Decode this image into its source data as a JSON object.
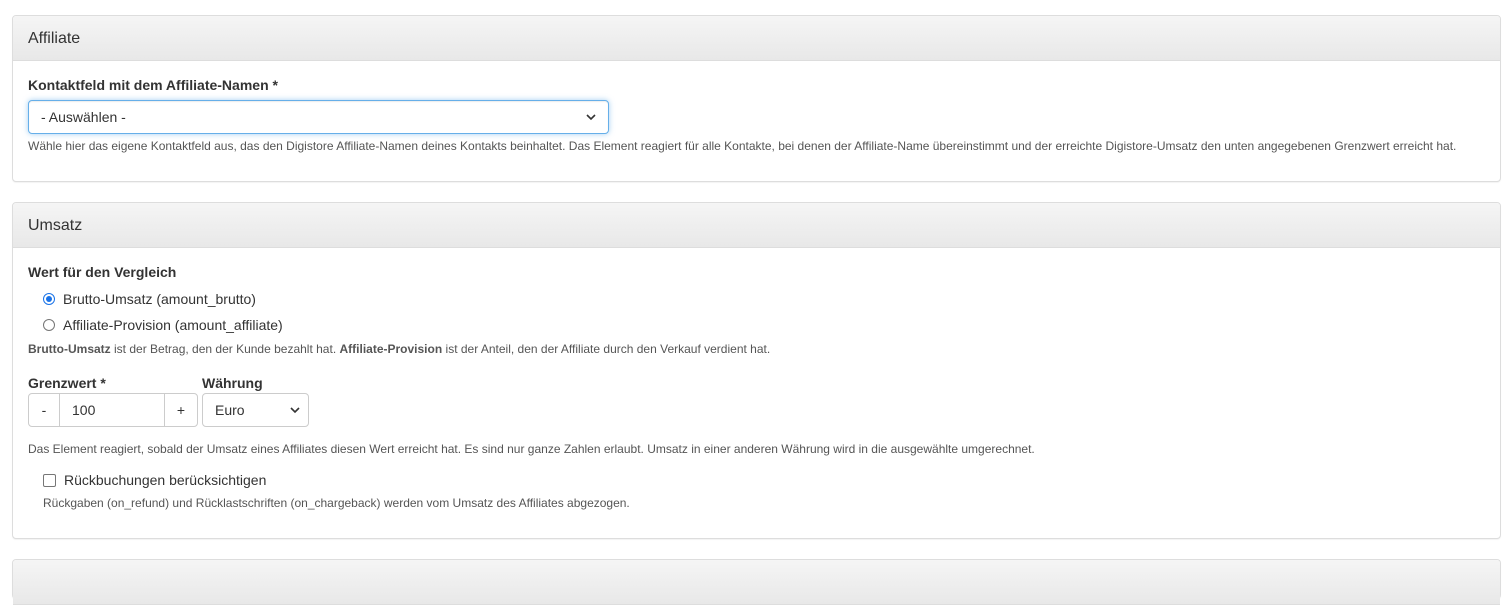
{
  "affiliate": {
    "title": "Affiliate",
    "field_label": "Kontaktfeld mit dem Affiliate-Namen *",
    "select_value": "- Auswählen -",
    "help": "Wähle hier das eigene Kontaktfeld aus, das den Digistore Affiliate-Namen deines Kontakts beinhaltet. Das Element reagiert für alle Kontakte, bei denen der Affiliate-Name übereinstimmt und der erreichte Digistore-Umsatz den unten angegebenen Grenzwert erreicht hat."
  },
  "umsatz": {
    "title": "Umsatz",
    "compare_label": "Wert für den Vergleich",
    "options": [
      {
        "label": "Brutto-Umsatz (amount_brutto)",
        "checked": true
      },
      {
        "label": "Affiliate-Provision (amount_affiliate)",
        "checked": false
      }
    ],
    "compare_help": {
      "term1": "Brutto-Umsatz",
      "text1": " ist der Betrag, den der Kunde bezahlt hat. ",
      "term2": "Affiliate-Provision",
      "text2": " ist der Anteil, den der Affiliate durch den Verkauf verdient hat."
    },
    "threshold_label": "Grenzwert *",
    "threshold_value": "100",
    "minus_label": "-",
    "plus_label": "+",
    "currency_label": "Währung",
    "currency_value": "Euro",
    "threshold_help": "Das Element reagiert, sobald der Umsatz eines Affiliates diesen Wert erreicht hat. Es sind nur ganze Zahlen erlaubt. Umsatz in einer anderen Währung wird in die ausgewählte umgerechnet.",
    "refund_label": "Rückbuchungen berücksichtigen",
    "refund_checked": false,
    "refund_help": "Rückgaben (on_refund) und Rücklastschriften (on_chargeback) werden vom Umsatz des Affiliates abgezogen."
  },
  "colors": {
    "focus_border": "#66afe9",
    "radio_accent": "#1a73e8",
    "panel_heading_bg": "#eeeeee"
  }
}
